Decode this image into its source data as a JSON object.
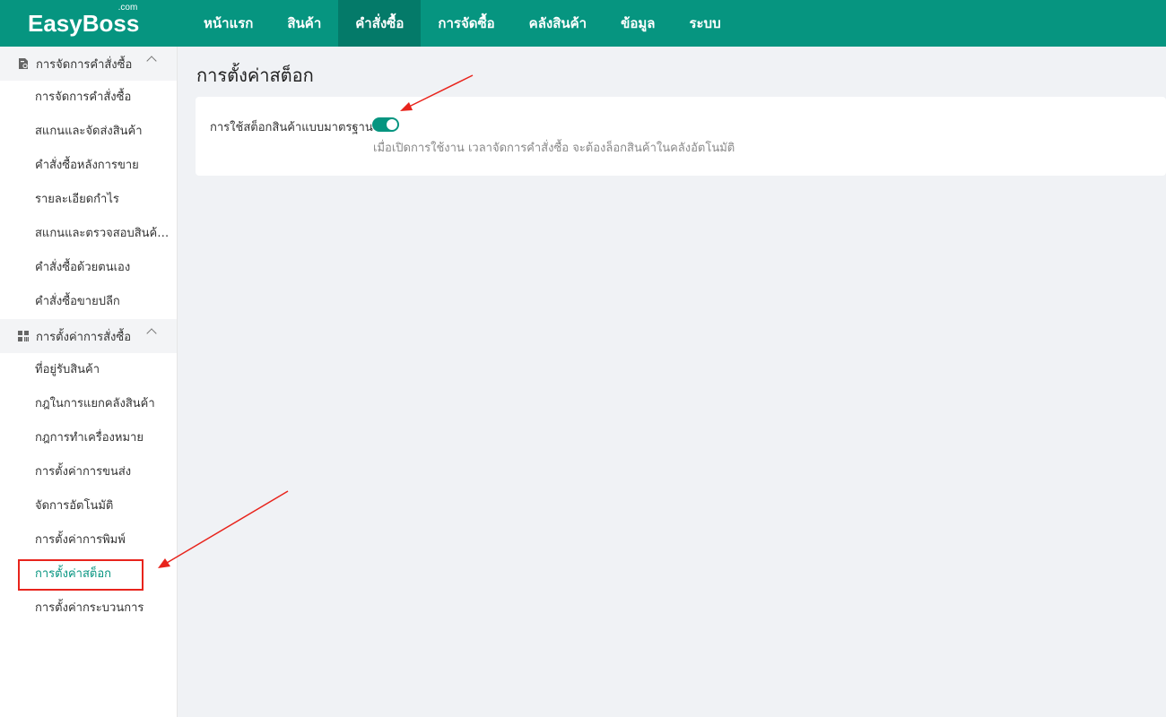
{
  "logo": {
    "text": "EasyBoss",
    "suffix": ".com"
  },
  "nav": {
    "items": [
      "หน้าแรก",
      "สินค้า",
      "คำสั่งซื้อ",
      "การจัดซื้อ",
      "คลังสินค้า",
      "ข้อมูล",
      "ระบบ"
    ],
    "active_index": 2
  },
  "sidebar": {
    "group1": {
      "title": "การจัดการคำสั่งซื้อ",
      "items": [
        "การจัดการคำสั่งซื้อ",
        "สแกนและจัดส่งสินค้า",
        "คำสั่งซื้อหลังการขาย",
        "รายละเอียดกำไร",
        "สแกนและตรวจสอบสินค้าก่อนส่ง",
        "คำสั่งซื้อด้วยตนเอง",
        "คำสั่งซื้อขายปลีก"
      ]
    },
    "group2": {
      "title": "การตั้งค่าการสั่งซื้อ",
      "items": [
        "ที่อยู่รับสินค้า",
        "กฎในการแยกคลังสินค้า",
        "กฎการทำเครื่องหมาย",
        "การตั้งค่าการขนส่ง",
        "จัดการอัตโนมัติ",
        "การตั้งค่าการพิมพ์",
        "การตั้งค่าสต็อก",
        "การตั้งค่ากระบวนการ"
      ],
      "active_index": 6
    }
  },
  "main": {
    "title": "การตั้งค่าสต็อก",
    "setting": {
      "label": "การใช้สต็อกสินค้าแบบมาตรฐาน",
      "enabled": true,
      "help": "เมื่อเปิดการใช้งาน เวลาจัดการคำสั่งซื้อ จะต้องล็อกสินค้าในคลังอัตโนมัติ"
    }
  },
  "colors": {
    "brand": "#069580",
    "brand_active": "#047a69",
    "annotation": "#e8241c"
  },
  "icons": {
    "group1": "order-document-icon",
    "group2": "grid-settings-icon",
    "toggle": "toggle-switch"
  }
}
